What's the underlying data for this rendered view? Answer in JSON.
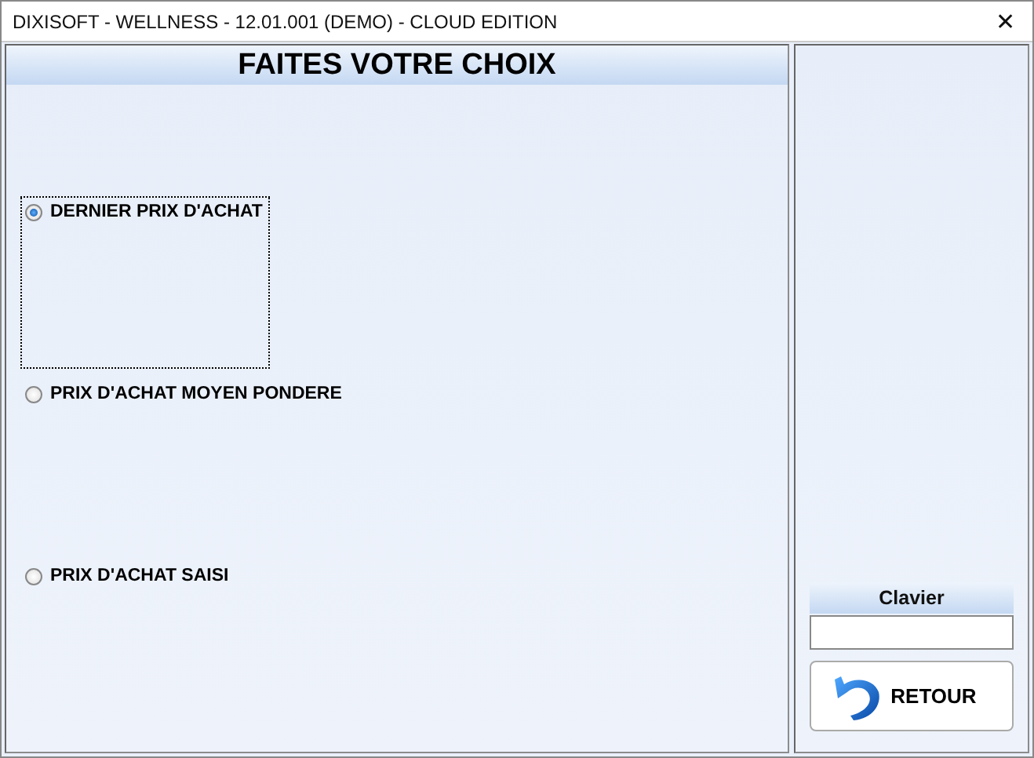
{
  "window": {
    "title": "DIXISOFT -  WELLNESS - 12.01.001 (DEMO) - CLOUD EDITION",
    "close": "✕"
  },
  "panel": {
    "title": "FAITES VOTRE CHOIX"
  },
  "options": [
    {
      "label": "DERNIER PRIX D'ACHAT",
      "selected": true
    },
    {
      "label": "PRIX D'ACHAT MOYEN PONDERE",
      "selected": false
    },
    {
      "label": "PRIX D'ACHAT SAISI",
      "selected": false
    }
  ],
  "keyboard": {
    "label": "Clavier"
  },
  "back_button": {
    "label": "RETOUR"
  }
}
